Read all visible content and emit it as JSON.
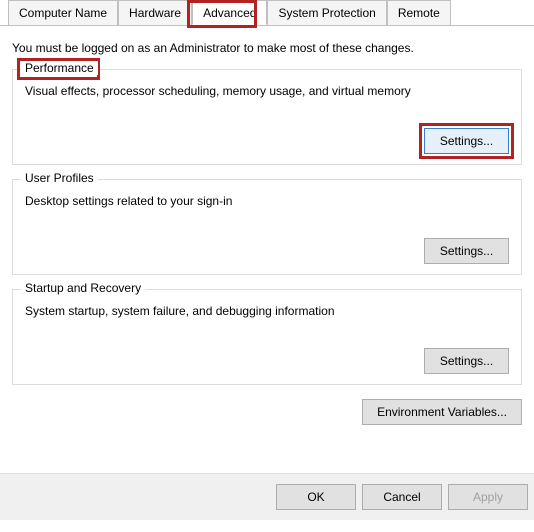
{
  "tabs": {
    "computer_name": "Computer Name",
    "hardware": "Hardware",
    "advanced": "Advanced",
    "system_protection": "System Protection",
    "remote": "Remote"
  },
  "admin_note": "You must be logged on as an Administrator to make most of these changes.",
  "groups": {
    "performance": {
      "label": "Performance",
      "desc": "Visual effects, processor scheduling, memory usage, and virtual memory",
      "button": "Settings..."
    },
    "user_profiles": {
      "label": "User Profiles",
      "desc": "Desktop settings related to your sign-in",
      "button": "Settings..."
    },
    "startup_recovery": {
      "label": "Startup and Recovery",
      "desc": "System startup, system failure, and debugging information",
      "button": "Settings..."
    }
  },
  "env_vars_button": "Environment Variables...",
  "dialog": {
    "ok": "OK",
    "cancel": "Cancel",
    "apply": "Apply"
  }
}
